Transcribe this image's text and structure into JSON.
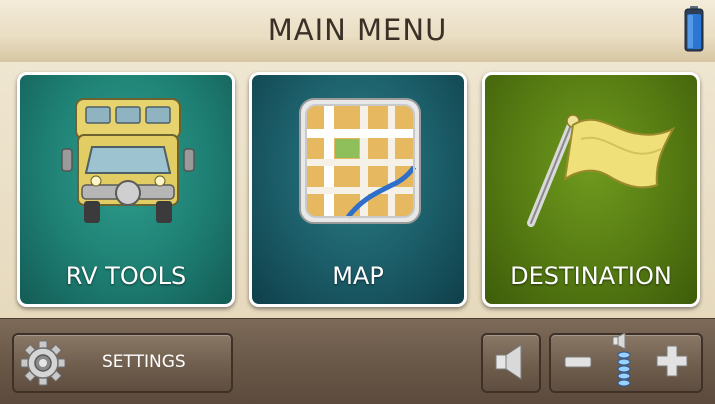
{
  "header": {
    "title": "MAIN MENU"
  },
  "status": {
    "battery_icon": "battery-icon"
  },
  "tiles": [
    {
      "id": "rv-tools",
      "label": "RV TOOLS",
      "icon": "rv-icon",
      "color": "#1e7f73"
    },
    {
      "id": "map",
      "label": "MAP",
      "icon": "map-icon",
      "color": "#1b5d68"
    },
    {
      "id": "destination",
      "label": "DESTINATION",
      "icon": "flag-icon",
      "color": "#557a12"
    }
  ],
  "bottom_bar": {
    "settings_label": "SETTINGS",
    "settings_icon": "gear-icon",
    "speaker_icon": "speaker-icon",
    "volume_down_icon": "minus-icon",
    "volume_up_icon": "plus-icon",
    "volume_level_icon": "volume-level-icon"
  }
}
